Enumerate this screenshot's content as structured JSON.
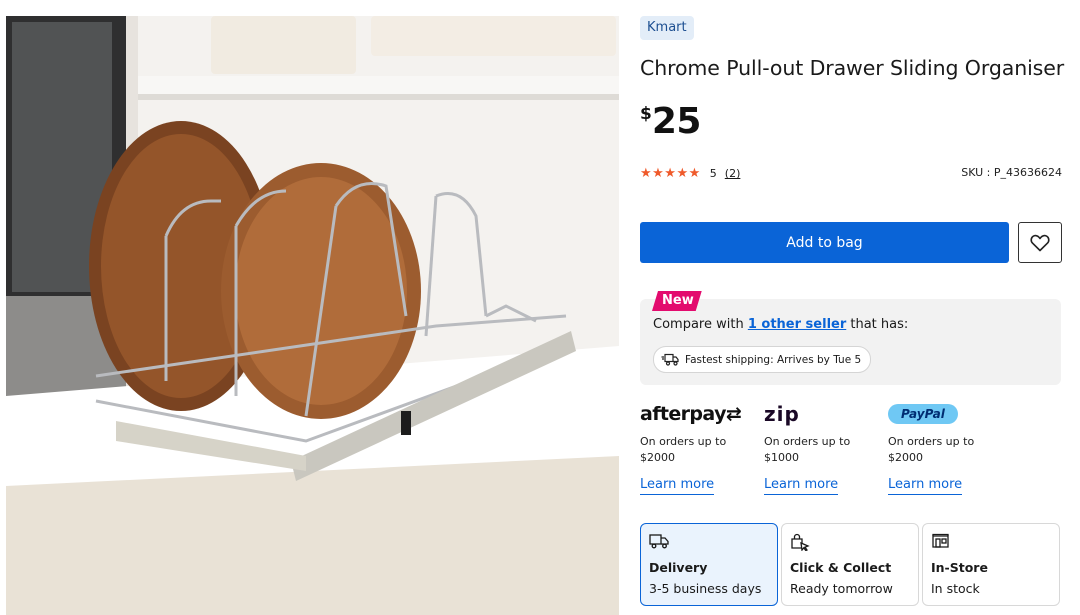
{
  "product": {
    "brand": "Kmart",
    "title": "Chrome Pull-out Drawer Sliding Organiser",
    "price_currency": "$",
    "price_amount": "25",
    "rating": {
      "stars": "★★★★★",
      "score": "5",
      "count": "(2)"
    },
    "sku": "SKU : P_43636624",
    "add_to_bag": "Add to bag"
  },
  "sellers": {
    "badge": "New",
    "compare_prefix": "Compare with ",
    "compare_link": "1 other seller",
    "compare_suffix": " that has:",
    "shipping_chip": "Fastest shipping: Arrives by Tue 5"
  },
  "payments": [
    {
      "name": "afterpay",
      "logo_text": "afterpay⇄",
      "desc": "On orders up to $2000",
      "link": "Learn more"
    },
    {
      "name": "zip",
      "logo_text": "zip",
      "desc": "On orders up to $1000",
      "link": "Learn more"
    },
    {
      "name": "paypal",
      "logo_text": "PayPal",
      "desc": "On orders up to $2000",
      "link": "Learn more"
    }
  ],
  "fulfilment": [
    {
      "icon": "delivery-truck-icon",
      "title": "Delivery",
      "subtitle": "3-5 business days",
      "selected": true
    },
    {
      "icon": "click-collect-icon",
      "title": "Click & Collect",
      "subtitle": "Ready tomorrow",
      "selected": false
    },
    {
      "icon": "store-icon",
      "title": "In-Store",
      "subtitle": "In stock",
      "selected": false
    }
  ],
  "colors": {
    "primary_blue": "#0a64d7",
    "new_badge": "#e30b6e",
    "stars": "#ef5a2b",
    "brand_badge_bg": "#e3edf8"
  }
}
